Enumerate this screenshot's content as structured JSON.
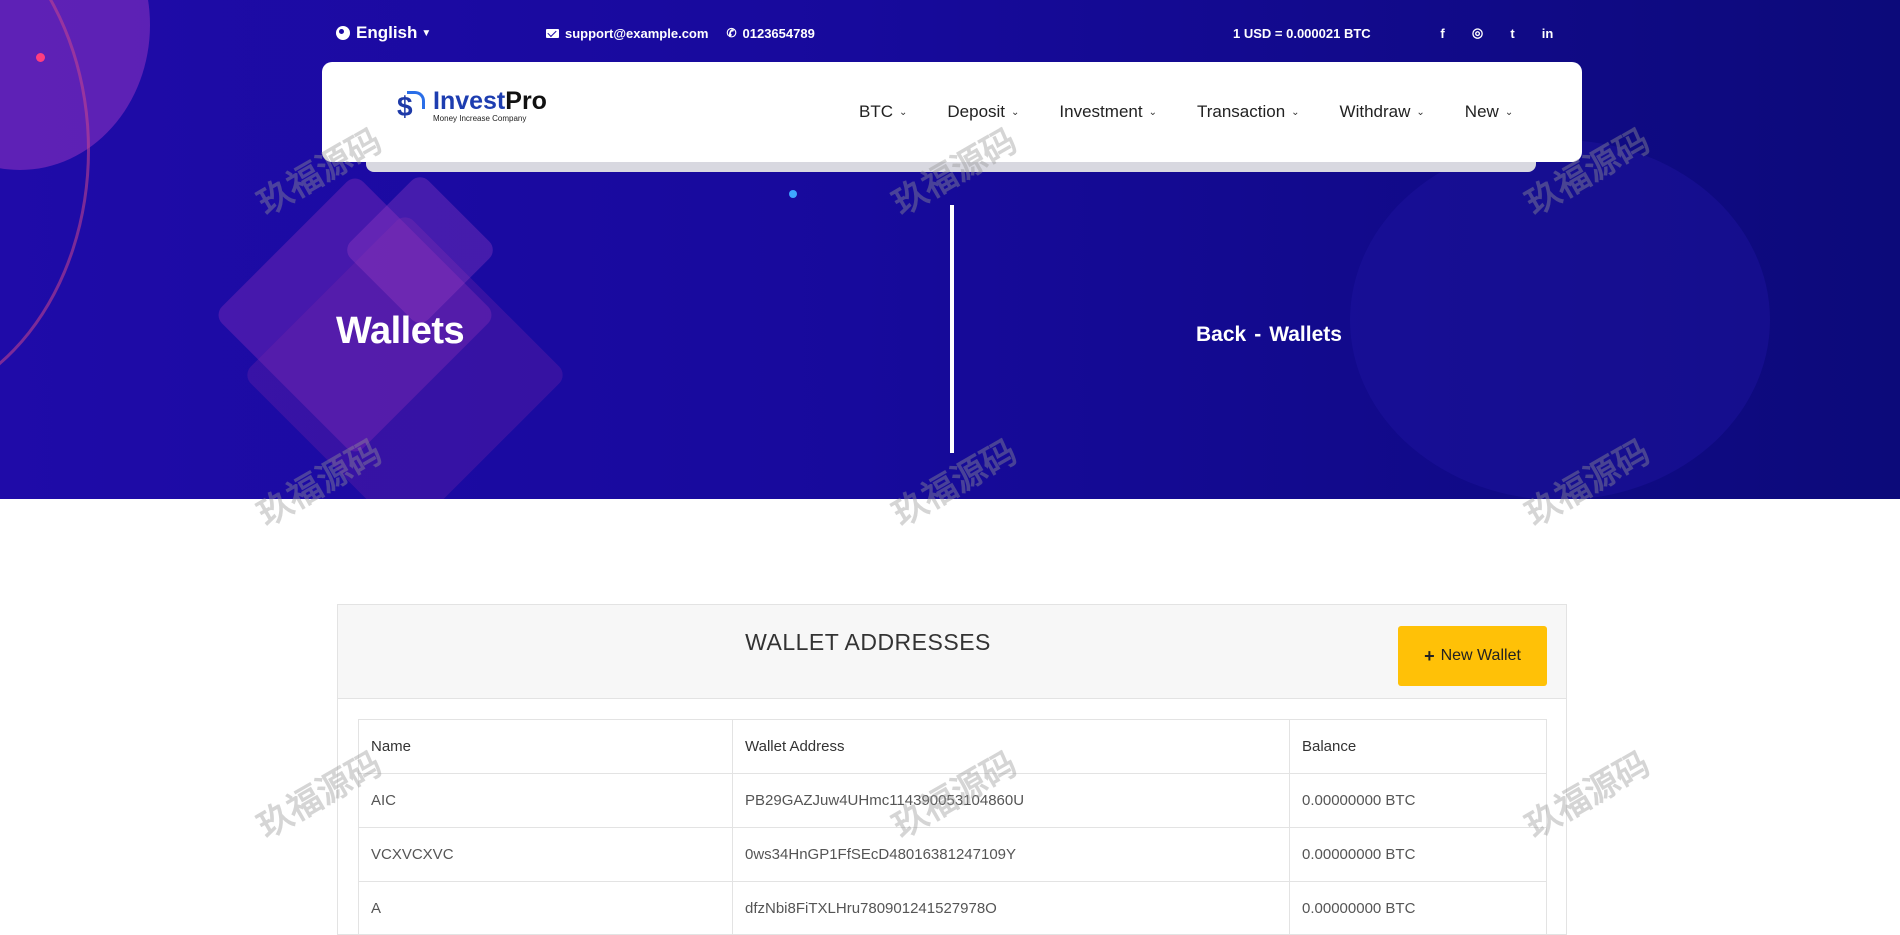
{
  "topbar": {
    "language": "English",
    "email": "support@example.com",
    "phone": "0123654789",
    "rate": "1 USD = 0.000021 BTC",
    "social": [
      "f",
      "◎",
      "t",
      "in"
    ]
  },
  "nav": {
    "logo_title_a": "Invest",
    "logo_title_b": "Pro",
    "logo_tagline": "Money Increase Company",
    "menu": [
      "BTC",
      "Deposit",
      "Investment",
      "Transaction",
      "Withdraw",
      "New"
    ]
  },
  "hero": {
    "title": "Wallets",
    "crumb_back": "Back",
    "crumb_sep": "-",
    "crumb_current": "Wallets"
  },
  "wallets": {
    "title": "WALLET ADDRESSES",
    "new_label": "New Wallet",
    "columns": [
      "Name",
      "Wallet Address",
      "Balance"
    ],
    "rows": [
      [
        "AIC",
        "PB29GAZJuw4UHmc114390053104860U",
        "0.00000000 BTC"
      ],
      [
        "VCXVCXVC",
        "0ws34HnGP1FfSEcD48016381247109Y",
        "0.00000000 BTC"
      ],
      [
        "A",
        "dfzNbi8FiTXLHru780901241527978O",
        "0.00000000 BTC"
      ]
    ]
  },
  "watermark": "玖福源码",
  "colors": {
    "hero_start": "#1f0ba8",
    "hero_end": "#0c0a7a",
    "button": "#ffc107"
  }
}
